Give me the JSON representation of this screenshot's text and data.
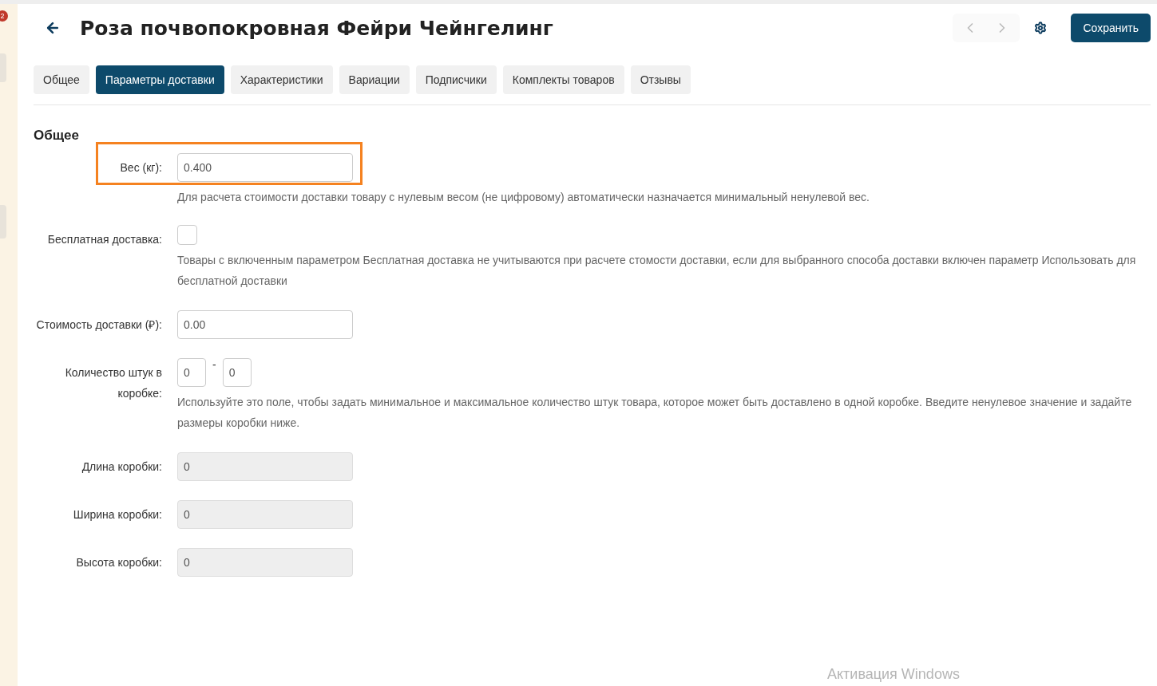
{
  "sidebar": {
    "badge": "2"
  },
  "header": {
    "title": "Роза почвопокровная Фейри Чейнгелинг",
    "prev_disabled": true,
    "next_disabled": true,
    "save_label": "Сохранить"
  },
  "tabs": [
    {
      "label": "Общее",
      "selected": false
    },
    {
      "label": "Параметры доставки",
      "selected": true
    },
    {
      "label": "Характеристики",
      "selected": false
    },
    {
      "label": "Вариации",
      "selected": false
    },
    {
      "label": "Подписчики",
      "selected": false
    },
    {
      "label": "Комплекты товаров",
      "selected": false
    },
    {
      "label": "Отзывы",
      "selected": false
    }
  ],
  "section_title": "Общее",
  "fields": [
    {
      "kind": "input",
      "label": "Вес (кг):",
      "value": "0.400",
      "disabled": false,
      "highlighted": true,
      "hint": "Для расчета стоимости доставки товару с нулевым весом (не цифровому) автоматически назначается минимальный ненулевой вес."
    },
    {
      "kind": "checkbox",
      "label": "Бесплатная доставка:",
      "checked": false,
      "hint": "Товары с включенным параметром Бесплатная доставка не учитываются при расчете стомости доставки, если для выбранного способа доставки включен параметр Использовать для бесплатной доставки"
    },
    {
      "kind": "input",
      "label": "Стоимость доставки (₽):",
      "value": "0.00",
      "disabled": false
    },
    {
      "kind": "range",
      "label": "Количество штук в коробке:",
      "values": [
        "0",
        "0"
      ],
      "separator": "-",
      "hint": "Используйте это поле, чтобы задать минимальное и максимальное количество штук товара, которое может быть доставлено в одной коробке. Введите ненулевое значение и задайте размеры коробки ниже."
    },
    {
      "kind": "input",
      "label": "Длина коробки:",
      "value": "0",
      "disabled": true
    },
    {
      "kind": "input",
      "label": "Ширина коробки:",
      "value": "0",
      "disabled": true
    },
    {
      "kind": "input",
      "label": "Высота коробки:",
      "value": "0",
      "disabled": true
    }
  ],
  "os_notice": "Активация Windows"
}
